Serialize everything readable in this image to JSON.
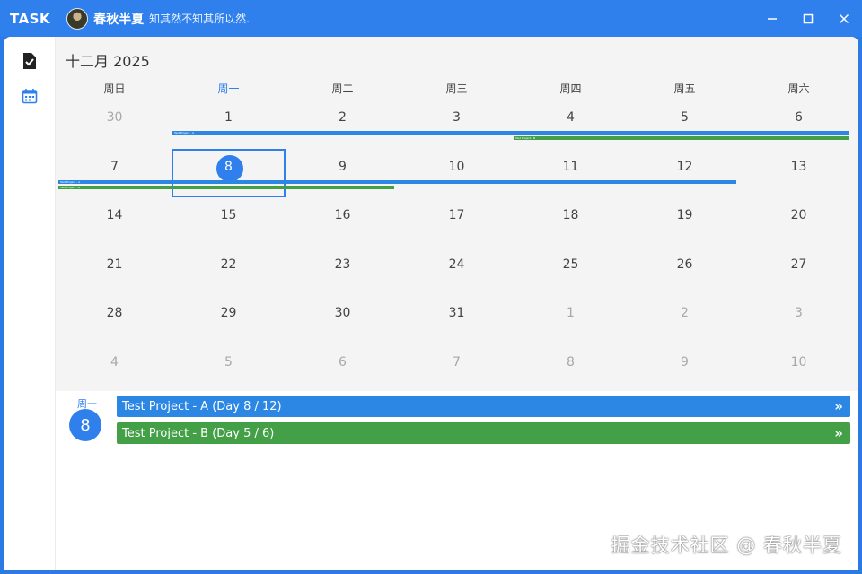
{
  "titlebar": {
    "app_name": "TASK",
    "user_name": "春秋半夏",
    "motto": "知其然不知其所以然."
  },
  "sidebar": {
    "items": [
      {
        "icon": "task-check-icon",
        "active": false
      },
      {
        "icon": "calendar-icon",
        "active": true
      }
    ]
  },
  "calendar": {
    "month_title": "十二月 2025",
    "weekdays": [
      "周日",
      "周一",
      "周二",
      "周三",
      "周四",
      "周五",
      "周六"
    ],
    "active_weekday_index": 1,
    "weeks": [
      [
        {
          "d": "30",
          "other": true
        },
        {
          "d": "1"
        },
        {
          "d": "2"
        },
        {
          "d": "3"
        },
        {
          "d": "4"
        },
        {
          "d": "5"
        },
        {
          "d": "6"
        }
      ],
      [
        {
          "d": "7"
        },
        {
          "d": "8",
          "selected": true
        },
        {
          "d": "9"
        },
        {
          "d": "10"
        },
        {
          "d": "11"
        },
        {
          "d": "12"
        },
        {
          "d": "13"
        }
      ],
      [
        {
          "d": "14"
        },
        {
          "d": "15"
        },
        {
          "d": "16"
        },
        {
          "d": "17"
        },
        {
          "d": "18"
        },
        {
          "d": "19"
        },
        {
          "d": "20"
        }
      ],
      [
        {
          "d": "21"
        },
        {
          "d": "22"
        },
        {
          "d": "23"
        },
        {
          "d": "24"
        },
        {
          "d": "25"
        },
        {
          "d": "26"
        },
        {
          "d": "27"
        }
      ],
      [
        {
          "d": "28"
        },
        {
          "d": "29"
        },
        {
          "d": "30"
        },
        {
          "d": "31"
        },
        {
          "d": "1",
          "other": true
        },
        {
          "d": "2",
          "other": true
        },
        {
          "d": "3",
          "other": true
        }
      ],
      [
        {
          "d": "4",
          "other": true
        },
        {
          "d": "5",
          "other": true
        },
        {
          "d": "6",
          "other": true
        },
        {
          "d": "7",
          "other": true
        },
        {
          "d": "8",
          "other": true
        },
        {
          "d": "9",
          "other": true
        },
        {
          "d": "10",
          "other": true
        }
      ]
    ],
    "mini_bar_label_a": "Test Project - A",
    "mini_bar_label_b": "Test Project - B"
  },
  "detail": {
    "weekday": "周一",
    "day": "8",
    "tasks": [
      {
        "label": "Test Project - A (Day 8 / 12)",
        "color": "#2b87e3"
      },
      {
        "label": "Test Project - B (Day 5 / 6)",
        "color": "#43a047"
      }
    ],
    "arrow": "»"
  },
  "watermark": "掘金技术社区 @ 春秋半夏",
  "colors": {
    "accent": "#2f80ed",
    "project_a": "#2b87e3",
    "project_b": "#43a047"
  }
}
